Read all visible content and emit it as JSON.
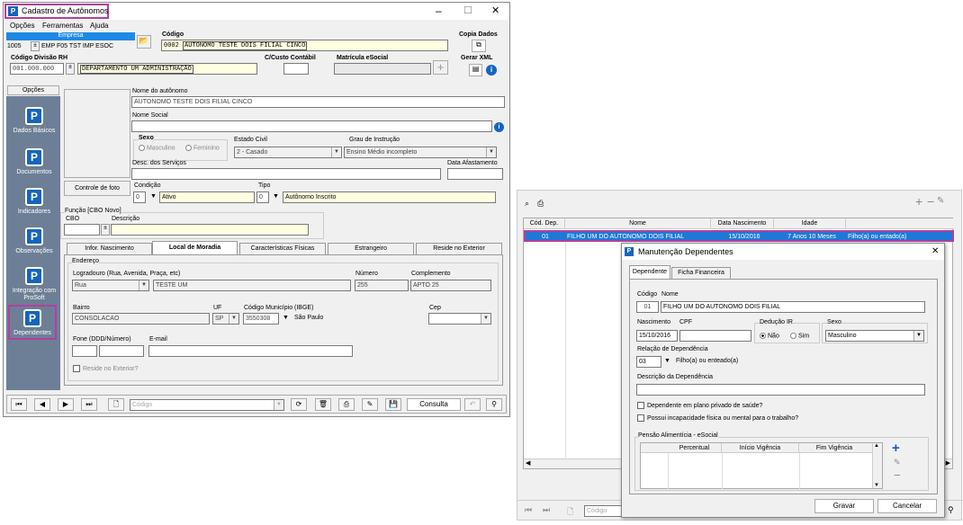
{
  "main_window": {
    "title": "Cadastro de Autônomos",
    "menu": [
      "Opções",
      "Ferramentas",
      "Ajuda"
    ],
    "empresa": {
      "label": "Empresa",
      "code": "1005",
      "value": "EMP F05 TST IMP ESOC"
    },
    "codigo": {
      "label": "Código",
      "code": "0002",
      "value": "AUTONOMO TESTE DOIS FILIAL CINCO"
    },
    "copia_dados": "Copia Dados",
    "divisao": {
      "label": "Código Divisão RH",
      "code": "001.000.000",
      "value": "DEPARTAMENTO UM ADMINISTRAÇÃO"
    },
    "ccusto_label": "C/Custo Contábil",
    "matricula_label": "Matrícula eSocial",
    "gerar_xml": "Gerar XML",
    "opcoes_label": "Opções",
    "sidebar": [
      "Dados Básicos",
      "Documentos",
      "Indicadores",
      "Observações",
      "Integração com ProSoft",
      "Dependentes"
    ],
    "nome_label": "Nome do autônomo",
    "nome_value": "AUTONOMO TESTE DOIS FILIAL CINCO",
    "nome_social_label": "Nome Social",
    "sexo_label": "Sexo",
    "sexo_masc": "Masculino",
    "sexo_fem": "Feminino",
    "estado_civil_label": "Estado Civil",
    "estado_civil_value": "2 - Casado",
    "grau_label": "Grau de Instrução",
    "grau_value": "Ensino Médio incompleto",
    "desc_servicos_label": "Desc. dos Serviços",
    "data_afast_label": "Data Afastamento",
    "controle_foto": "Controle de foto",
    "condicao_label": "Condição",
    "condicao_code": "0",
    "condicao_value": "Ativo",
    "tipo_label": "Tipo",
    "tipo_code": "0",
    "tipo_value": "Autônomo Inscrito",
    "funcao_label": "Função [CBO Novo]",
    "cbo_label": "CBO",
    "descricao_label": "Descrição",
    "tabs": [
      "Infor. Nascimento",
      "Local de Moradia",
      "Características Físicas",
      "Estrangeiro",
      "Reside no Exterior"
    ],
    "endereco_label": "Endereço",
    "logradouro_label": "Logradouro (Rua, Avenida, Praça, etc)",
    "logradouro_tipo": "Rua",
    "logradouro_value": "TESTE UM",
    "numero_label": "Número",
    "numero_value": "255",
    "complemento_label": "Complemento",
    "complemento_value": "APTO 25",
    "bairro_label": "Bairro",
    "bairro_value": "CONSOLACAO",
    "uf_label": "UF",
    "uf_value": "SP",
    "municipio_label": "Código Município (IBGE)",
    "municipio_code": "3550308",
    "municipio_value": "São Paulo",
    "cep_label": "Cep",
    "fone_label": "Fone (DDD/Número)",
    "email_label": "E-mail",
    "reside_exterior": "Reside no Exterior?",
    "toolbar_placeholder": "Código",
    "consulta": "Consulta"
  },
  "dep_grid": {
    "headers": [
      "Cód. Dep.",
      "Nome",
      "Data Nascimento",
      "Idade",
      ""
    ],
    "row": [
      "01",
      "FILHO UM DO AUTONOMO DOIS FILIAL",
      "15/10/2016",
      "7 Anos 10 Meses",
      "Filho(a) ou entado(a)"
    ],
    "toolbar_placeholder": "Código"
  },
  "dialog": {
    "title": "Manutenção Dependentes",
    "tabs": [
      "Dependente",
      "Ficha Financeira"
    ],
    "codigo_label": "Código",
    "nome_label": "Nome",
    "codigo_value": "01",
    "nome_value": "FILHO UM DO AUTONOMO DOIS FILIAL",
    "nascimento_label": "Nascimento",
    "cpf_label": "CPF",
    "nascimento_value": "15/10/2016",
    "deducao_label": "Dedução IR",
    "nao": "Não",
    "sim": "Sim",
    "sexo_label": "Sexo",
    "sexo_value": "Masculino",
    "relacao_label": "Relação de Dependência",
    "relacao_code": "03",
    "relacao_value": "Filho(a) ou enteado(a)",
    "descricao_label": "Descrição da Dependência",
    "chk1": "Dependente em plano privado de saúde?",
    "chk2": "Possui incapacidade física ou mental para o trabalho?",
    "pensao_label": "Pensão Alimentícia - eSocial",
    "pensao_headers": [
      "Percentual",
      "Início Vigência",
      "Fim Vigência"
    ],
    "gravar": "Gravar",
    "cancelar": "Cancelar"
  }
}
